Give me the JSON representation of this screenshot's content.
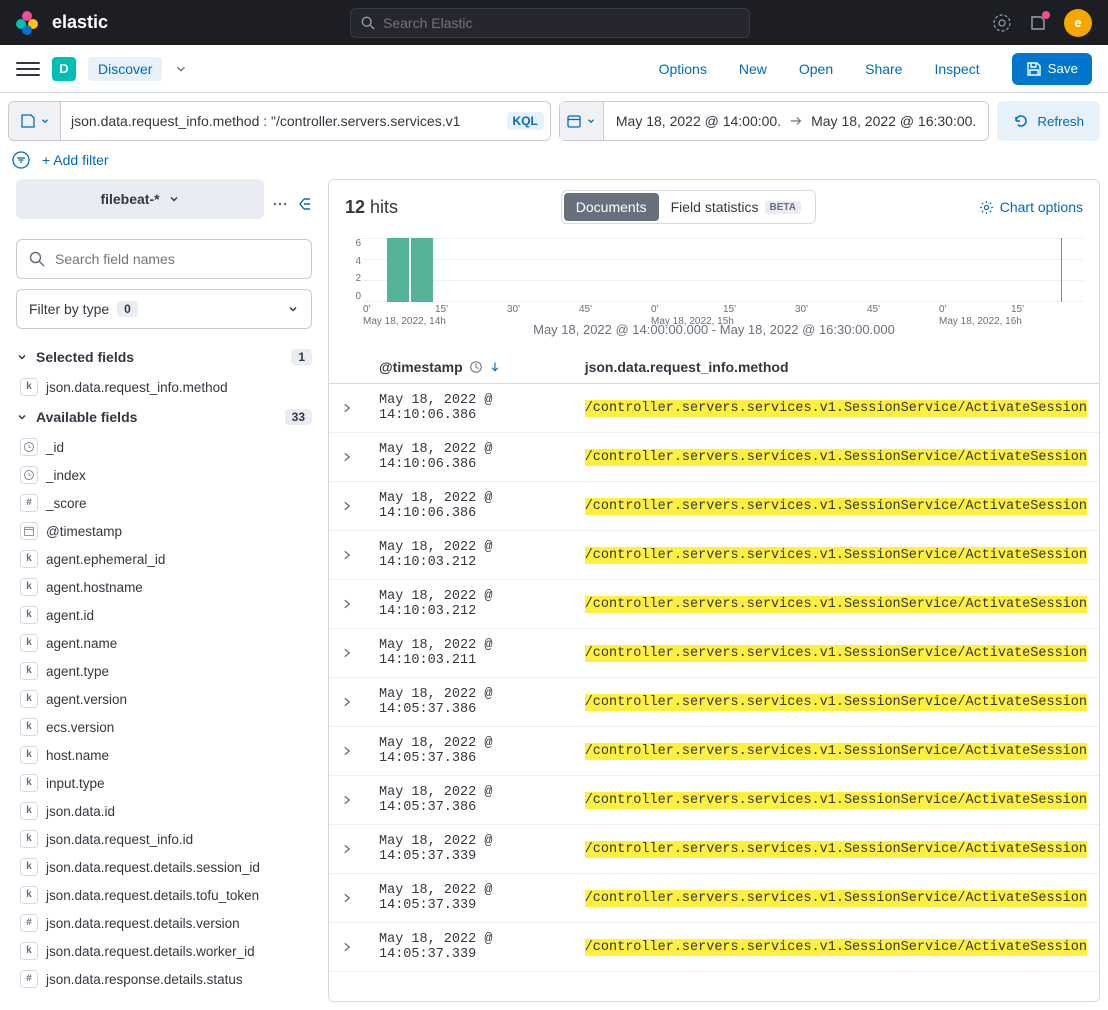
{
  "header": {
    "brand": "elastic",
    "search_placeholder": "Search Elastic",
    "avatar_initial": "e"
  },
  "subheader": {
    "badge": "D",
    "app": "Discover",
    "nav": {
      "options": "Options",
      "new": "New",
      "open": "Open",
      "share": "Share",
      "inspect": "Inspect",
      "save": "Save"
    }
  },
  "query": {
    "text": "json.data.request_info.method : \"/controller.servers.services.v1",
    "lang": "KQL",
    "from": "May 18, 2022 @ 14:00:00.",
    "to": "May 18, 2022 @ 16:30:00.",
    "refresh": "Refresh"
  },
  "filters": {
    "add": "+ Add filter"
  },
  "sidebar": {
    "index": "filebeat-*",
    "search_placeholder": "Search field names",
    "filter_type": "Filter by type",
    "filter_type_count": "0",
    "selected_label": "Selected fields",
    "selected_count": "1",
    "selected_fields": [
      {
        "t": "k",
        "name": "json.data.request_info.method"
      }
    ],
    "available_label": "Available fields",
    "available_count": "33",
    "available_fields": [
      {
        "t": "clock",
        "name": "_id"
      },
      {
        "t": "clock",
        "name": "_index"
      },
      {
        "t": "#",
        "name": "_score"
      },
      {
        "t": "cal",
        "name": "@timestamp"
      },
      {
        "t": "k",
        "name": "agent.ephemeral_id"
      },
      {
        "t": "k",
        "name": "agent.hostname"
      },
      {
        "t": "k",
        "name": "agent.id"
      },
      {
        "t": "k",
        "name": "agent.name"
      },
      {
        "t": "k",
        "name": "agent.type"
      },
      {
        "t": "k",
        "name": "agent.version"
      },
      {
        "t": "k",
        "name": "ecs.version"
      },
      {
        "t": "k",
        "name": "host.name"
      },
      {
        "t": "k",
        "name": "input.type"
      },
      {
        "t": "k",
        "name": "json.data.id"
      },
      {
        "t": "k",
        "name": "json.data.request_info.id"
      },
      {
        "t": "k",
        "name": "json.data.request.details.session_id"
      },
      {
        "t": "k",
        "name": "json.data.request.details.tofu_token"
      },
      {
        "t": "#",
        "name": "json.data.request.details.version"
      },
      {
        "t": "k",
        "name": "json.data.request.details.worker_id"
      },
      {
        "t": "#",
        "name": "json.data.response.details.status"
      }
    ]
  },
  "content": {
    "hits_count": "12",
    "hits_label": "hits",
    "tabs": {
      "documents": "Documents",
      "field_stats": "Field statistics",
      "beta": "BETA"
    },
    "chart_options": "Chart options",
    "histo_caption": "May 18, 2022 @ 14:00:00.000 - May 18, 2022 @ 16:30:00.000",
    "columns": {
      "ts": "@timestamp",
      "method": "json.data.request_info.method"
    },
    "rows": [
      {
        "ts": "May 18, 2022 @ 14:10:06.386",
        "m": "/controller.servers.services.v1.SessionService/ActivateSession"
      },
      {
        "ts": "May 18, 2022 @ 14:10:06.386",
        "m": "/controller.servers.services.v1.SessionService/ActivateSession"
      },
      {
        "ts": "May 18, 2022 @ 14:10:06.386",
        "m": "/controller.servers.services.v1.SessionService/ActivateSession"
      },
      {
        "ts": "May 18, 2022 @ 14:10:03.212",
        "m": "/controller.servers.services.v1.SessionService/ActivateSession"
      },
      {
        "ts": "May 18, 2022 @ 14:10:03.212",
        "m": "/controller.servers.services.v1.SessionService/ActivateSession"
      },
      {
        "ts": "May 18, 2022 @ 14:10:03.211",
        "m": "/controller.servers.services.v1.SessionService/ActivateSession"
      },
      {
        "ts": "May 18, 2022 @ 14:05:37.386",
        "m": "/controller.servers.services.v1.SessionService/ActivateSession"
      },
      {
        "ts": "May 18, 2022 @ 14:05:37.386",
        "m": "/controller.servers.services.v1.SessionService/ActivateSession"
      },
      {
        "ts": "May 18, 2022 @ 14:05:37.386",
        "m": "/controller.servers.services.v1.SessionService/ActivateSession"
      },
      {
        "ts": "May 18, 2022 @ 14:05:37.339",
        "m": "/controller.servers.services.v1.SessionService/ActivateSession"
      },
      {
        "ts": "May 18, 2022 @ 14:05:37.339",
        "m": "/controller.servers.services.v1.SessionService/ActivateSession"
      },
      {
        "ts": "May 18, 2022 @ 14:05:37.339",
        "m": "/controller.servers.services.v1.SessionService/ActivateSession"
      }
    ]
  },
  "chart_data": {
    "type": "bar",
    "title": "",
    "xlabel": "",
    "ylabel": "",
    "ylim": [
      0,
      6
    ],
    "yticks": [
      0,
      2,
      4,
      6
    ],
    "x_minor_ticks": [
      "0'",
      "15'",
      "30'",
      "45'",
      "0'",
      "15'",
      "30'",
      "45'",
      "0'",
      "15'"
    ],
    "x_major_labels": [
      "May 18, 2022, 14h",
      "May 18, 2022, 15h",
      "May 18, 2022, 16h"
    ],
    "categories": [
      "14:05",
      "14:10"
    ],
    "values": [
      6,
      6
    ]
  }
}
